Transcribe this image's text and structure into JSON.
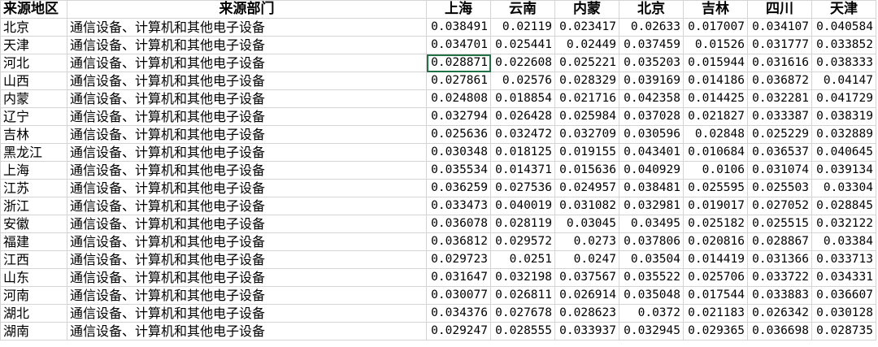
{
  "headers": [
    "来源地区",
    "来源部门",
    "上海",
    "云南",
    "内蒙",
    "北京",
    "吉林",
    "四川",
    "天津"
  ],
  "rows": [
    {
      "region": "北京",
      "dept": "通信设备、计算机和其他电子设备",
      "values": [
        "0.038491",
        "0.02119",
        "0.023417",
        "0.02633",
        "0.017007",
        "0.034107",
        "0.040584"
      ]
    },
    {
      "region": "天津",
      "dept": "通信设备、计算机和其他电子设备",
      "values": [
        "0.034701",
        "0.025441",
        "0.02449",
        "0.037459",
        "0.01526",
        "0.031777",
        "0.033852"
      ]
    },
    {
      "region": "河北",
      "dept": "通信设备、计算机和其他电子设备",
      "values": [
        "0.028871",
        "0.022608",
        "0.025221",
        "0.035203",
        "0.015944",
        "0.031616",
        "0.038333"
      ]
    },
    {
      "region": "山西",
      "dept": "通信设备、计算机和其他电子设备",
      "values": [
        "0.027861",
        "0.02576",
        "0.028329",
        "0.039169",
        "0.014186",
        "0.036872",
        "0.04147"
      ]
    },
    {
      "region": "内蒙",
      "dept": "通信设备、计算机和其他电子设备",
      "values": [
        "0.024808",
        "0.018854",
        "0.021716",
        "0.042358",
        "0.014425",
        "0.032281",
        "0.041729"
      ]
    },
    {
      "region": "辽宁",
      "dept": "通信设备、计算机和其他电子设备",
      "values": [
        "0.032794",
        "0.026428",
        "0.025984",
        "0.037028",
        "0.021827",
        "0.033387",
        "0.038319"
      ]
    },
    {
      "region": "吉林",
      "dept": "通信设备、计算机和其他电子设备",
      "values": [
        "0.025636",
        "0.032472",
        "0.032709",
        "0.030596",
        "0.02848",
        "0.025229",
        "0.032889"
      ]
    },
    {
      "region": "黑龙江",
      "dept": "通信设备、计算机和其他电子设备",
      "values": [
        "0.030348",
        "0.018125",
        "0.019155",
        "0.043401",
        "0.010684",
        "0.036537",
        "0.040645"
      ]
    },
    {
      "region": "上海",
      "dept": "通信设备、计算机和其他电子设备",
      "values": [
        "0.035534",
        "0.014371",
        "0.015636",
        "0.040929",
        "0.0106",
        "0.031074",
        "0.039134"
      ]
    },
    {
      "region": "江苏",
      "dept": "通信设备、计算机和其他电子设备",
      "values": [
        "0.036259",
        "0.027536",
        "0.024957",
        "0.038481",
        "0.025595",
        "0.025503",
        "0.03304"
      ]
    },
    {
      "region": "浙江",
      "dept": "通信设备、计算机和其他电子设备",
      "values": [
        "0.033473",
        "0.040019",
        "0.031082",
        "0.032981",
        "0.019017",
        "0.027052",
        "0.028845"
      ]
    },
    {
      "region": "安徽",
      "dept": "通信设备、计算机和其他电子设备",
      "values": [
        "0.036078",
        "0.028119",
        "0.03045",
        "0.03495",
        "0.025182",
        "0.025515",
        "0.032122"
      ]
    },
    {
      "region": "福建",
      "dept": "通信设备、计算机和其他电子设备",
      "values": [
        "0.036812",
        "0.029572",
        "0.0273",
        "0.037806",
        "0.020816",
        "0.028867",
        "0.03384"
      ]
    },
    {
      "region": "江西",
      "dept": "通信设备、计算机和其他电子设备",
      "values": [
        "0.029723",
        "0.0251",
        "0.0247",
        "0.03504",
        "0.014419",
        "0.031366",
        "0.033713"
      ]
    },
    {
      "region": "山东",
      "dept": "通信设备、计算机和其他电子设备",
      "values": [
        "0.031647",
        "0.032198",
        "0.037567",
        "0.035522",
        "0.025706",
        "0.033722",
        "0.034331"
      ]
    },
    {
      "region": "河南",
      "dept": "通信设备、计算机和其他电子设备",
      "values": [
        "0.030077",
        "0.026811",
        "0.026914",
        "0.035048",
        "0.017544",
        "0.033883",
        "0.036607"
      ]
    },
    {
      "region": "湖北",
      "dept": "通信设备、计算机和其他电子设备",
      "values": [
        "0.034376",
        "0.027678",
        "0.028623",
        "0.0372",
        "0.021183",
        "0.026342",
        "0.030128"
      ]
    },
    {
      "region": "湖南",
      "dept": "通信设备、计算机和其他电子设备",
      "values": [
        "0.029247",
        "0.028555",
        "0.033937",
        "0.032945",
        "0.029365",
        "0.036698",
        "0.028735"
      ]
    }
  ],
  "selection": {
    "row": 2,
    "col": 0
  },
  "colors": {
    "gridline": "#d4d4d4",
    "selection": "#217346"
  }
}
